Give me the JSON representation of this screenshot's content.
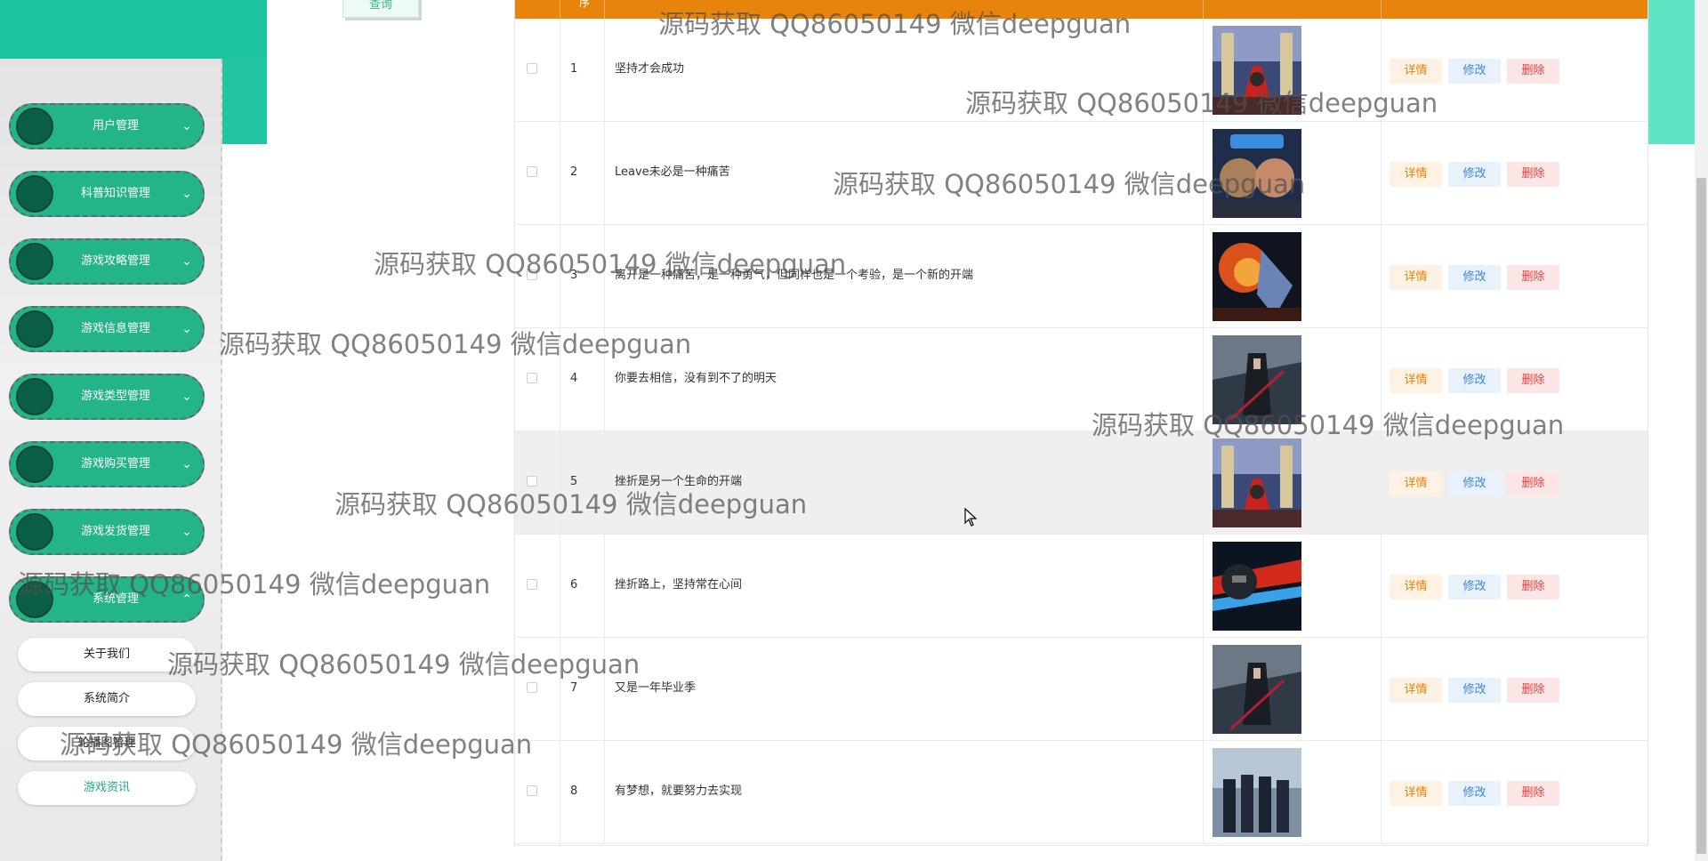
{
  "query_button": {
    "label": "查询"
  },
  "sidebar": {
    "menus": [
      {
        "label": "用户管理",
        "chevron": "chevron-down-icon"
      },
      {
        "label": "科普知识管理",
        "chevron": "chevron-down-icon"
      },
      {
        "label": "游戏攻略管理",
        "chevron": "chevron-down-icon"
      },
      {
        "label": "游戏信息管理",
        "chevron": "chevron-down-icon"
      },
      {
        "label": "游戏类型管理",
        "chevron": "chevron-down-icon"
      },
      {
        "label": "游戏购买管理",
        "chevron": "chevron-down-icon"
      },
      {
        "label": "游戏发货管理",
        "chevron": "chevron-down-icon"
      },
      {
        "label": "系统管理",
        "chevron": "chevron-up-icon"
      }
    ],
    "sub_items": [
      {
        "label": "关于我们"
      },
      {
        "label": "系统简介"
      },
      {
        "label": "轮播图管理"
      },
      {
        "label": "游戏资讯",
        "active": true
      }
    ]
  },
  "table": {
    "header_index_label": "序",
    "actions": {
      "detail": "详情",
      "edit": "修改",
      "delete": "删除"
    },
    "rows": [
      {
        "index": "1",
        "title": "坚持才会成功",
        "image": "fantasy-hall"
      },
      {
        "index": "2",
        "title": "Leave未必是一种痛苦",
        "image": "game-poster"
      },
      {
        "index": "3",
        "title": "离开是一种痛苦，是一种勇气，但同样也是一个考验，是一个新的开端",
        "image": "fire-warrior"
      },
      {
        "index": "4",
        "title": "你要去相信，没有到不了的明天",
        "image": "dark-swordsman"
      },
      {
        "index": "5",
        "title": "挫折是另一个生命的开端",
        "image": "fantasy-hall",
        "hover": true
      },
      {
        "index": "6",
        "title": "挫折路上，坚持常在心间",
        "image": "red-mech"
      },
      {
        "index": "7",
        "title": "又是一年毕业季",
        "image": "dark-swordsman"
      },
      {
        "index": "8",
        "title": "有梦想，就要努力去实现",
        "image": "group-heroes"
      }
    ]
  },
  "watermark": {
    "text": "源码获取 QQ86050149 微信deepguan"
  },
  "colors": {
    "accent_green": "#24b48a",
    "header_orange": "#e8830c",
    "detail": "#e8830c",
    "edit": "#3b86e0",
    "delete": "#e04545"
  }
}
